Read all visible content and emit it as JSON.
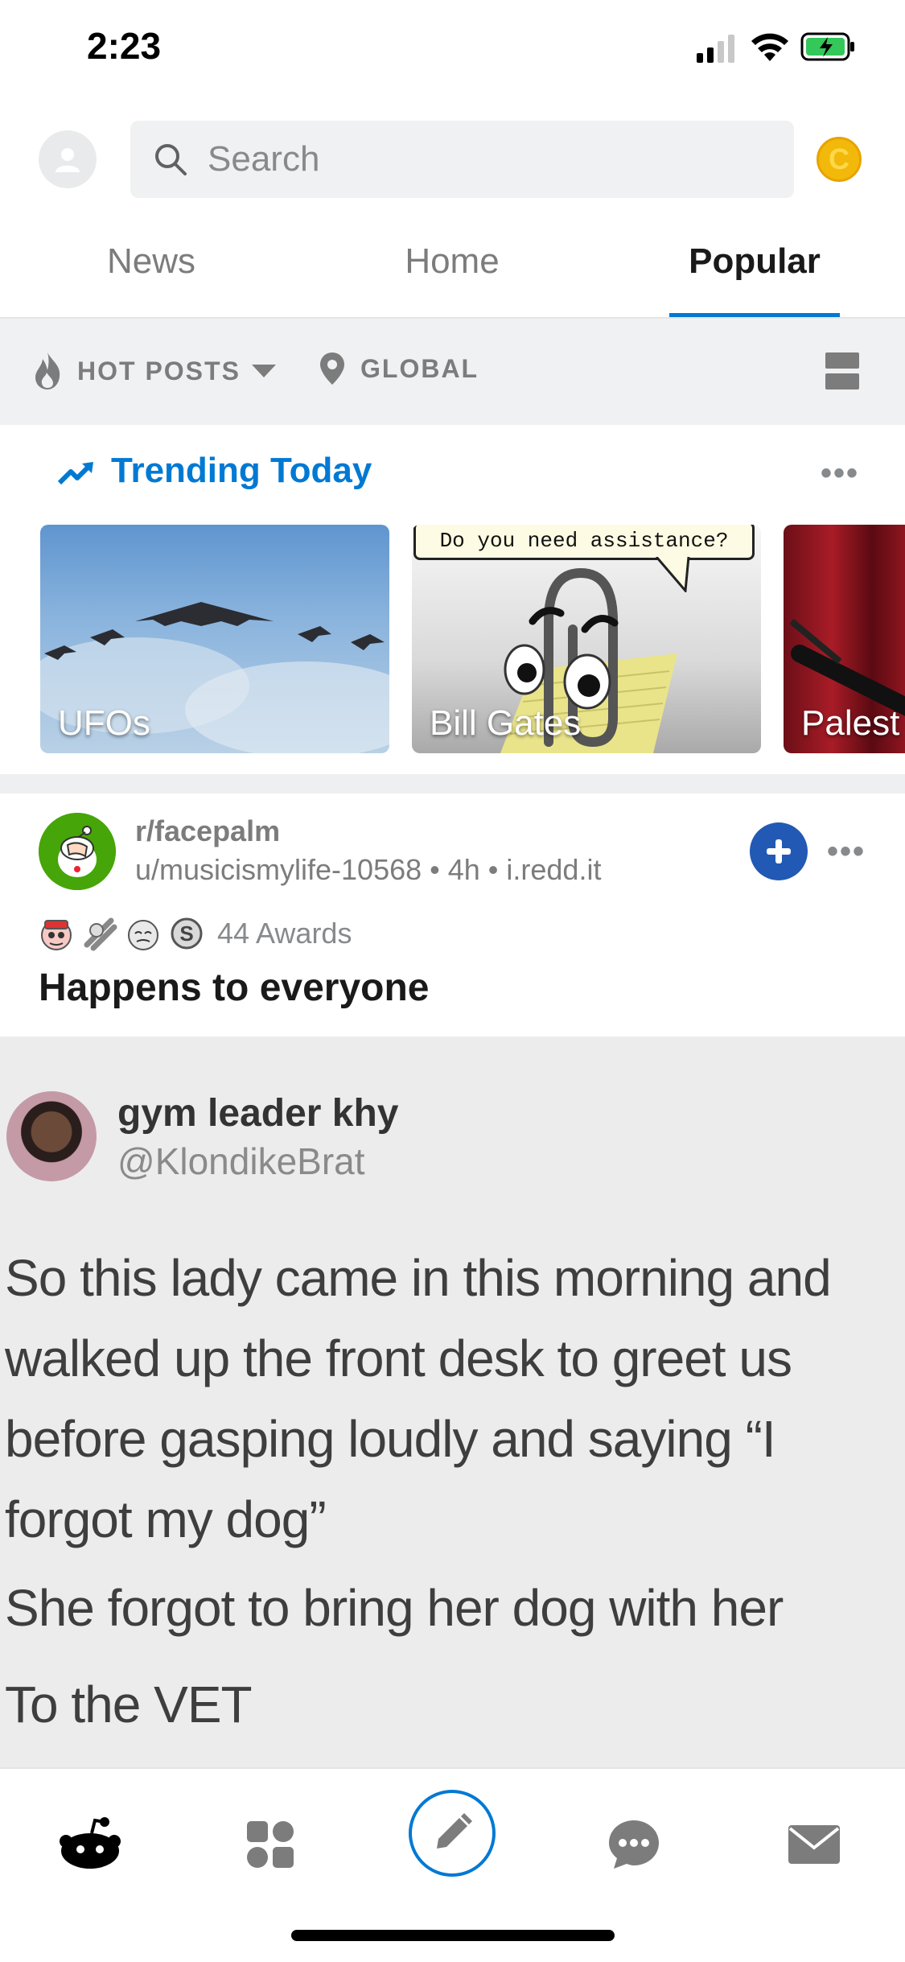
{
  "status_bar": {
    "time": "2:23"
  },
  "header": {
    "search_placeholder": "Search",
    "coin_letter": "C"
  },
  "tabs": [
    {
      "label": "News"
    },
    {
      "label": "Home"
    },
    {
      "label": "Popular"
    }
  ],
  "filters": {
    "sort_label": "HOT POSTS",
    "location_label": "GLOBAL"
  },
  "trending": {
    "title": "Trending Today",
    "more": "•••",
    "cards": [
      {
        "label": "UFOs"
      },
      {
        "label": "Bill Gates",
        "speech_bubble": "Do you need assistance?"
      },
      {
        "label": "Palest"
      }
    ]
  },
  "post": {
    "subreddit": "r/facepalm",
    "meta": "u/musicismylife-10568 • 4h • i.redd.it",
    "awards_text": "44 Awards",
    "title": "Happens to everyone",
    "more": "•••",
    "tweet": {
      "name": "gym leader khy",
      "handle": "@KlondikeBrat",
      "lines": [
        "So this lady came in this morning and walked up the front desk to greet us before gasping loudly and saying “I forgot my dog”",
        "She forgot to bring her dog with her",
        "To the VET"
      ]
    }
  },
  "colors": {
    "accent": "#0079d3",
    "join": "#2159b5",
    "muted": "#7c7c7c"
  }
}
